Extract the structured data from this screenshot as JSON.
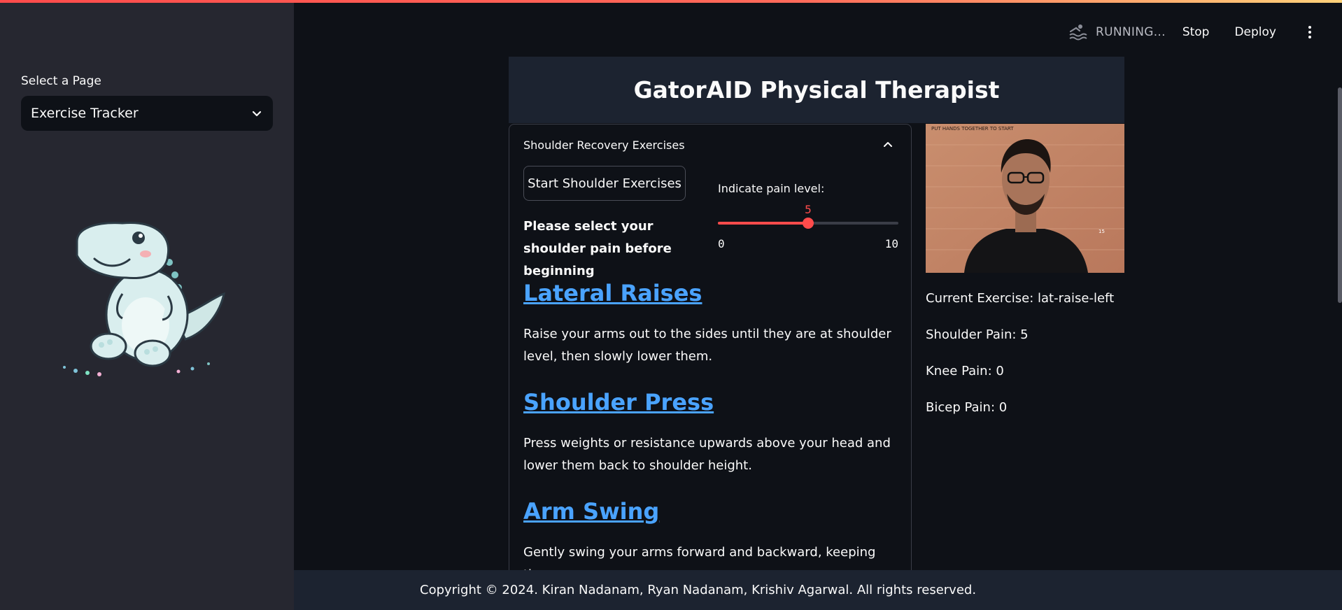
{
  "sidebar": {
    "select_label": "Select a Page",
    "select_value": "Exercise Tracker"
  },
  "toolbar": {
    "status": "RUNNING...",
    "stop_label": "Stop",
    "deploy_label": "Deploy"
  },
  "app": {
    "title": "GatorAID Physical Therapist"
  },
  "expander": {
    "title": "Shoulder Recovery Exercises",
    "start_button": "Start Shoulder Exercises",
    "pain_note": "Please select your shoulder pain before beginning",
    "slider": {
      "label": "Indicate pain level:",
      "value": 5,
      "min": 0,
      "max": 10
    },
    "exercises": [
      {
        "name": "Lateral Raises",
        "description": "Raise your arms out to the sides until they are at shoulder level, then slowly lower them."
      },
      {
        "name": "Shoulder Press",
        "description": "Press weights or resistance upwards above your head and lower them back to shoulder height."
      },
      {
        "name": "Arm Swing",
        "description": "Gently swing your arms forward and backward, keeping them"
      }
    ]
  },
  "webcam": {
    "overlay_text": "PUT HANDS TOGETHER TO START",
    "shirt_text": "15"
  },
  "status": {
    "current_exercise": "Current Exercise: lat-raise-left",
    "shoulder_pain": "Shoulder Pain: 5",
    "knee_pain": "Knee Pain: 0",
    "bicep_pain": "Bicep Pain: 0"
  },
  "footer": {
    "copyright": "Copyright © 2024. Kiran Nadanam, Ryan Nadanam, Krishiv Agarwal. All rights reserved."
  },
  "colors": {
    "accent": "#ff4b4b",
    "link": "#4aa3ff",
    "background": "#0e1117",
    "sidebar": "#262730"
  }
}
